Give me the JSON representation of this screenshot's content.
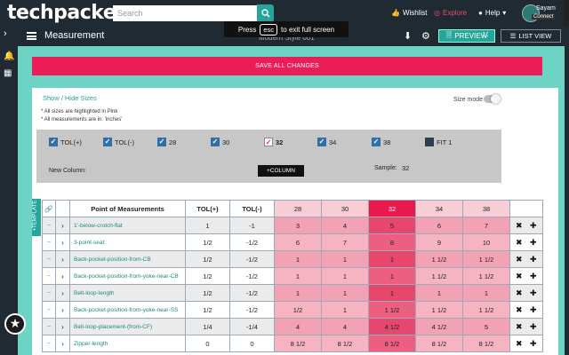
{
  "app": {
    "logo": "techpacker",
    "search_placeholder": "Search",
    "wishlist": "Wishlist",
    "explore": "Explore",
    "help": "Help",
    "user_name": "Sayam",
    "user_sub": "Connect"
  },
  "header": {
    "title": "Measurement",
    "style_name": "Modern Style 001",
    "preview_label": "PREVIEW",
    "list_view_label": "LIST VIEW"
  },
  "toast": {
    "press": "Press",
    "key": "esc",
    "message": "to exit full screen"
  },
  "save_label": "SAVE ALL CHANGES",
  "panel": {
    "show_hide": "Show / Hide Sizes",
    "note1": "* All sizes are highlighted in Pink",
    "note2": "* All measurements are in: 'inches'",
    "size_mode": "Size mode",
    "new_column": "New Column:",
    "add_column": "+COLUMN",
    "sample_label": "Sample:",
    "sample_value": "32"
  },
  "checkboxes": [
    {
      "label": "TOL(+)",
      "state": "checked"
    },
    {
      "label": "TOL(-)",
      "state": "checked"
    },
    {
      "label": "28",
      "state": "checked"
    },
    {
      "label": "30",
      "state": "checked"
    },
    {
      "label": "32",
      "state": "sample"
    },
    {
      "label": "34",
      "state": "checked"
    },
    {
      "label": "38",
      "state": "checked"
    },
    {
      "label": "FIT 1",
      "state": "unchecked"
    }
  ],
  "template_tab": "+TEMPLATE",
  "table": {
    "headers": {
      "pom": "Point of Measurements",
      "tol_plus": "TOL(+)",
      "tol_minus": "TOL(-)",
      "s28": "28",
      "s30": "30",
      "s32": "32",
      "s34": "34",
      "s38": "38"
    },
    "rows": [
      {
        "name": "1'-below-crotch-flat",
        "tp": "1",
        "tm": "-1",
        "s28": "3",
        "s30": "4",
        "s32": "5",
        "s34": "6",
        "s38": "7"
      },
      {
        "name": "3-point-seat",
        "tp": "1/2",
        "tm": "-1/2",
        "s28": "6",
        "s30": "7",
        "s32": "8",
        "s34": "9",
        "s38": "10"
      },
      {
        "name": "Back-pocket-position-from-CB",
        "tp": "1/2",
        "tm": "-1/2",
        "s28": "1",
        "s30": "1",
        "s32": "1",
        "s34": "1 1/2",
        "s38": "1 1/2"
      },
      {
        "name": "Back-pocket-position-from-yoke-near-CB",
        "tp": "1/2",
        "tm": "-1/2",
        "s28": "1",
        "s30": "1",
        "s32": "1",
        "s34": "1 1/2",
        "s38": "1 1/2"
      },
      {
        "name": "Belt-loop-length",
        "tp": "1/2",
        "tm": "-1/2",
        "s28": "1",
        "s30": "1",
        "s32": "1",
        "s34": "1",
        "s38": "1"
      },
      {
        "name": "Back-pocket-position-from-yoke-near-SS",
        "tp": "1/2",
        "tm": "-1/2",
        "s28": "1/2",
        "s30": "1",
        "s32": "1 1/2",
        "s34": "1 1/2",
        "s38": "1 1/2"
      },
      {
        "name": "Belt-loop-placement-(from-CF)",
        "tp": "1/4",
        "tm": "-1/4",
        "s28": "4",
        "s30": "4",
        "s32": "4 1/2",
        "s34": "4 1/2",
        "s38": "5"
      },
      {
        "name": "Zipper-length",
        "tp": "0",
        "tm": "0",
        "s28": "8 1/2",
        "s30": "8 1/2",
        "s32": "8 1/2",
        "s34": "8 1/2",
        "s38": "8 1/2"
      }
    ]
  }
}
